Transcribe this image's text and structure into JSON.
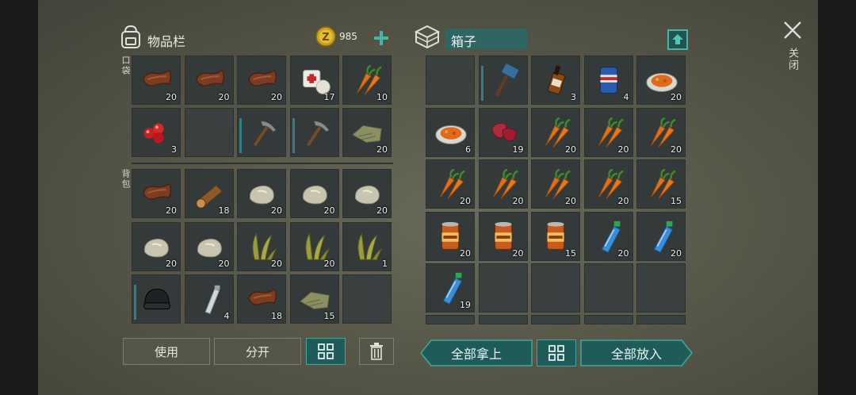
{
  "inventory": {
    "title": "物品栏",
    "coins": "985",
    "pockets_label": "口袋",
    "backpack_label": "背包",
    "pockets": [
      {
        "item": "leather",
        "count": "20"
      },
      {
        "item": "leather",
        "count": "20"
      },
      {
        "item": "leather",
        "count": "20"
      },
      {
        "item": "bandage",
        "count": "17"
      },
      {
        "item": "carrot",
        "count": "10"
      },
      {
        "item": "berries",
        "count": "3"
      },
      {
        "item": "",
        "count": ""
      },
      {
        "item": "pickaxe",
        "count": "",
        "durability": true
      },
      {
        "item": "pickaxe",
        "count": "",
        "durability": true
      },
      {
        "item": "cloth",
        "count": "20"
      }
    ],
    "backpack": [
      {
        "item": "leather",
        "count": "20"
      },
      {
        "item": "log",
        "count": "18"
      },
      {
        "item": "stone",
        "count": "20"
      },
      {
        "item": "stone",
        "count": "20"
      },
      {
        "item": "stone",
        "count": "20"
      },
      {
        "item": "stone",
        "count": "20"
      },
      {
        "item": "stone",
        "count": "20"
      },
      {
        "item": "plant-fiber",
        "count": "20"
      },
      {
        "item": "plant-fiber",
        "count": "20"
      },
      {
        "item": "plant-fiber",
        "count": "1"
      },
      {
        "item": "beanie",
        "count": "",
        "durability": true
      },
      {
        "item": "water-bottle-empty",
        "count": "4"
      },
      {
        "item": "leather",
        "count": "18"
      },
      {
        "item": "cloth",
        "count": "15"
      },
      {
        "item": "",
        "count": ""
      }
    ],
    "buttons": {
      "use": "使用",
      "split": "分开"
    }
  },
  "box": {
    "title": "箱子",
    "slots": [
      {
        "item": "",
        "count": ""
      },
      {
        "item": "sledgehammer",
        "count": "",
        "durability": true
      },
      {
        "item": "whiskey",
        "count": "3"
      },
      {
        "item": "beer-can",
        "count": "4"
      },
      {
        "item": "stew-plate",
        "count": "20"
      },
      {
        "item": "stew-plate",
        "count": "6"
      },
      {
        "item": "raw-meat",
        "count": "19"
      },
      {
        "item": "carrot",
        "count": "20"
      },
      {
        "item": "carrot",
        "count": "20"
      },
      {
        "item": "carrot",
        "count": "20"
      },
      {
        "item": "carrot",
        "count": "20"
      },
      {
        "item": "carrot",
        "count": "20"
      },
      {
        "item": "carrot",
        "count": "20"
      },
      {
        "item": "carrot",
        "count": "20"
      },
      {
        "item": "carrot",
        "count": "15"
      },
      {
        "item": "canned-food",
        "count": "20"
      },
      {
        "item": "canned-food",
        "count": "20"
      },
      {
        "item": "canned-food",
        "count": "15"
      },
      {
        "item": "water-bottle",
        "count": "20"
      },
      {
        "item": "water-bottle",
        "count": "20"
      },
      {
        "item": "water-bottle",
        "count": "19"
      },
      {
        "item": "",
        "count": ""
      },
      {
        "item": "",
        "count": ""
      },
      {
        "item": "",
        "count": ""
      },
      {
        "item": "",
        "count": ""
      }
    ],
    "buttons": {
      "take_all": "全部拿上",
      "put_all": "全部放入"
    }
  },
  "close": {
    "label": "关闭"
  },
  "colors": {
    "accent": "#3fa6a0",
    "slot": "#343a3a",
    "durability": "#2f7f86"
  }
}
